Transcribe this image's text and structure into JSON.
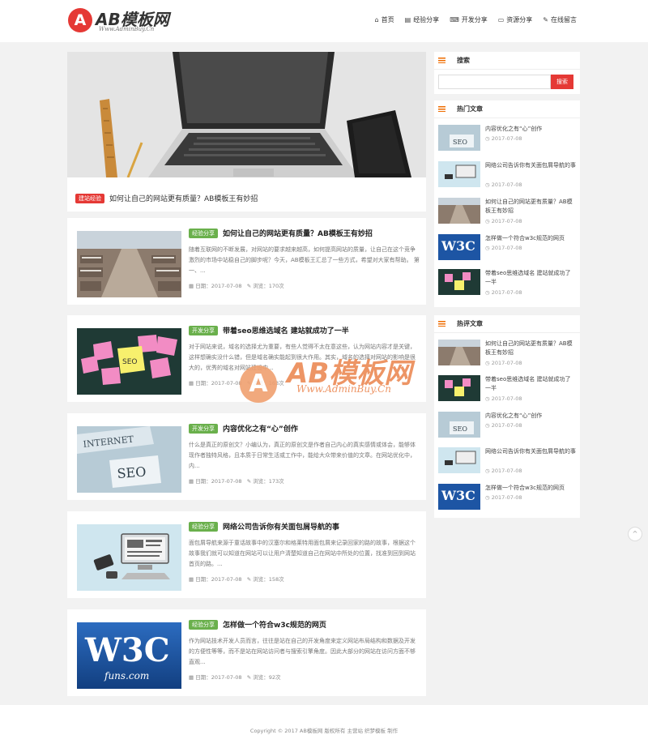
{
  "header": {
    "logo_mark": "A",
    "logo_text": "AB模板网",
    "logo_sub": "Www.AdminBuy.Cn",
    "nav": [
      {
        "icon": "home-icon",
        "glyph": "⌂",
        "label": "首页"
      },
      {
        "icon": "list-icon",
        "glyph": "▤",
        "label": "经验分享"
      },
      {
        "icon": "code-icon",
        "glyph": "⌨",
        "label": "开发分享"
      },
      {
        "icon": "monitor-icon",
        "glyph": "▭",
        "label": "资源分享"
      },
      {
        "icon": "comment-icon",
        "glyph": "✎",
        "label": "在线留言"
      }
    ]
  },
  "featured": {
    "tag": "建站经验",
    "title": "如何让自己的网站更有质量？AB模板王有妙招"
  },
  "posts": [
    {
      "tag": "经验分享",
      "tag_color": "#6ab04c",
      "title": "如何让自己的网站更有质量？AB模板王有妙招",
      "excerpt": "随着互联网的不断发展，对网站的要求越来越高，如何提高网站的质量，让自己在这个竞争激烈的市场中站稳自己的脚步呢？今天，AB模板王汇总了一些方式，希望对大家有帮助。 第一、...",
      "date": "日期：2017-07-08",
      "views": "浏览：170次"
    },
    {
      "tag": "开发分享",
      "tag_color": "#6ab04c",
      "title": "带着seo思维选域名 建站就成功了一半",
      "excerpt": "对于网站来说，域名的选择尤为重要，有些人觉得不太在意这些，认为网站内容才是关键，这样想确实没什么错，但是域名确实能起到很大作用。其实，域名的选择对网站的影响是很大的，优秀的域名对网站建设中...",
      "date": "日期：2017-07-08",
      "views": "浏览：163次"
    },
    {
      "tag": "开发分享",
      "tag_color": "#6ab04c",
      "title": "内容优化之有“心”创作",
      "excerpt": "什么是真正的原创文？小编认为，真正的原创文是作者自己内心的真实感情或体会，能够体现作者独特风格，且本质于日常生活或工作中，能给大众带来价值的文章。在网站优化中，内...",
      "date": "日期：2017-07-08",
      "views": "浏览：173次"
    },
    {
      "tag": "经验分享",
      "tag_color": "#6ab04c",
      "title": "网络公司告诉你有关面包屑导航的事",
      "excerpt": "面包屑导航来源于童话故事中的汉塞尔和格莱特用面包屑来记录回家的路的故事，根据这个故事我们就可以知道在网站可以让用户清楚知道自己在网站中所处的位置，找准到回到网站首页的路。...",
      "date": "日期：2017-07-08",
      "views": "浏览：158次"
    },
    {
      "tag": "经验分享",
      "tag_color": "#6ab04c",
      "title": "怎样做一个符合w3c规范的网页",
      "excerpt": "作为网站技术开发人员而言，往往是站在自己的开发角度来定义网站布局结构和数据及开发的方便性等等，而不是站在网站访问者与搜索引擎角度。因此大部分的网站在访问方面不够直观...",
      "date": "日期：2017-07-08",
      "views": "浏览：92次"
    }
  ],
  "sidebar": {
    "search": {
      "title": "搜索",
      "placeholder": "",
      "button": "搜索"
    },
    "hot": {
      "title": "热门文章",
      "items": [
        {
          "title": "内容优化之有“心”创作",
          "date": "2017-07-08"
        },
        {
          "title": "网络公司告诉你有关面包屑导航的事",
          "date": "2017-07-08"
        },
        {
          "title": "如何让自己的网站更有质量？AB模板王有妙招",
          "date": "2017-07-08"
        },
        {
          "title": "怎样做一个符合w3c规范的网页",
          "date": "2017-07-08"
        },
        {
          "title": "带着seo思维选域名 建站就成功了一半",
          "date": "2017-07-08"
        }
      ]
    },
    "comment": {
      "title": "热评文章",
      "items": [
        {
          "title": "如何让自己的网站更有质量？AB模板王有妙招",
          "date": "2017-07-08"
        },
        {
          "title": "带着seo思维选域名 建站就成功了一半",
          "date": "2017-07-08"
        },
        {
          "title": "内容优化之有“心”创作",
          "date": "2017-07-08"
        },
        {
          "title": "网络公司告诉你有关面包屑导航的事",
          "date": "2017-07-08"
        },
        {
          "title": "怎样做一个符合w3c规范的网页",
          "date": "2017-07-08"
        }
      ]
    }
  },
  "back_to_top": "^",
  "footer": {
    "text": "Copyright © 2017 AB模板网 版权所有 主营站 织梦模板 制作"
  },
  "watermark": {
    "mark": "A",
    "text": "AB模板网",
    "sub": "Www.AdminBuy.Cn"
  },
  "colors": {
    "brand_red": "#e53935",
    "tag_green": "#6ab04c",
    "widget_icon": "#ef6c00"
  }
}
